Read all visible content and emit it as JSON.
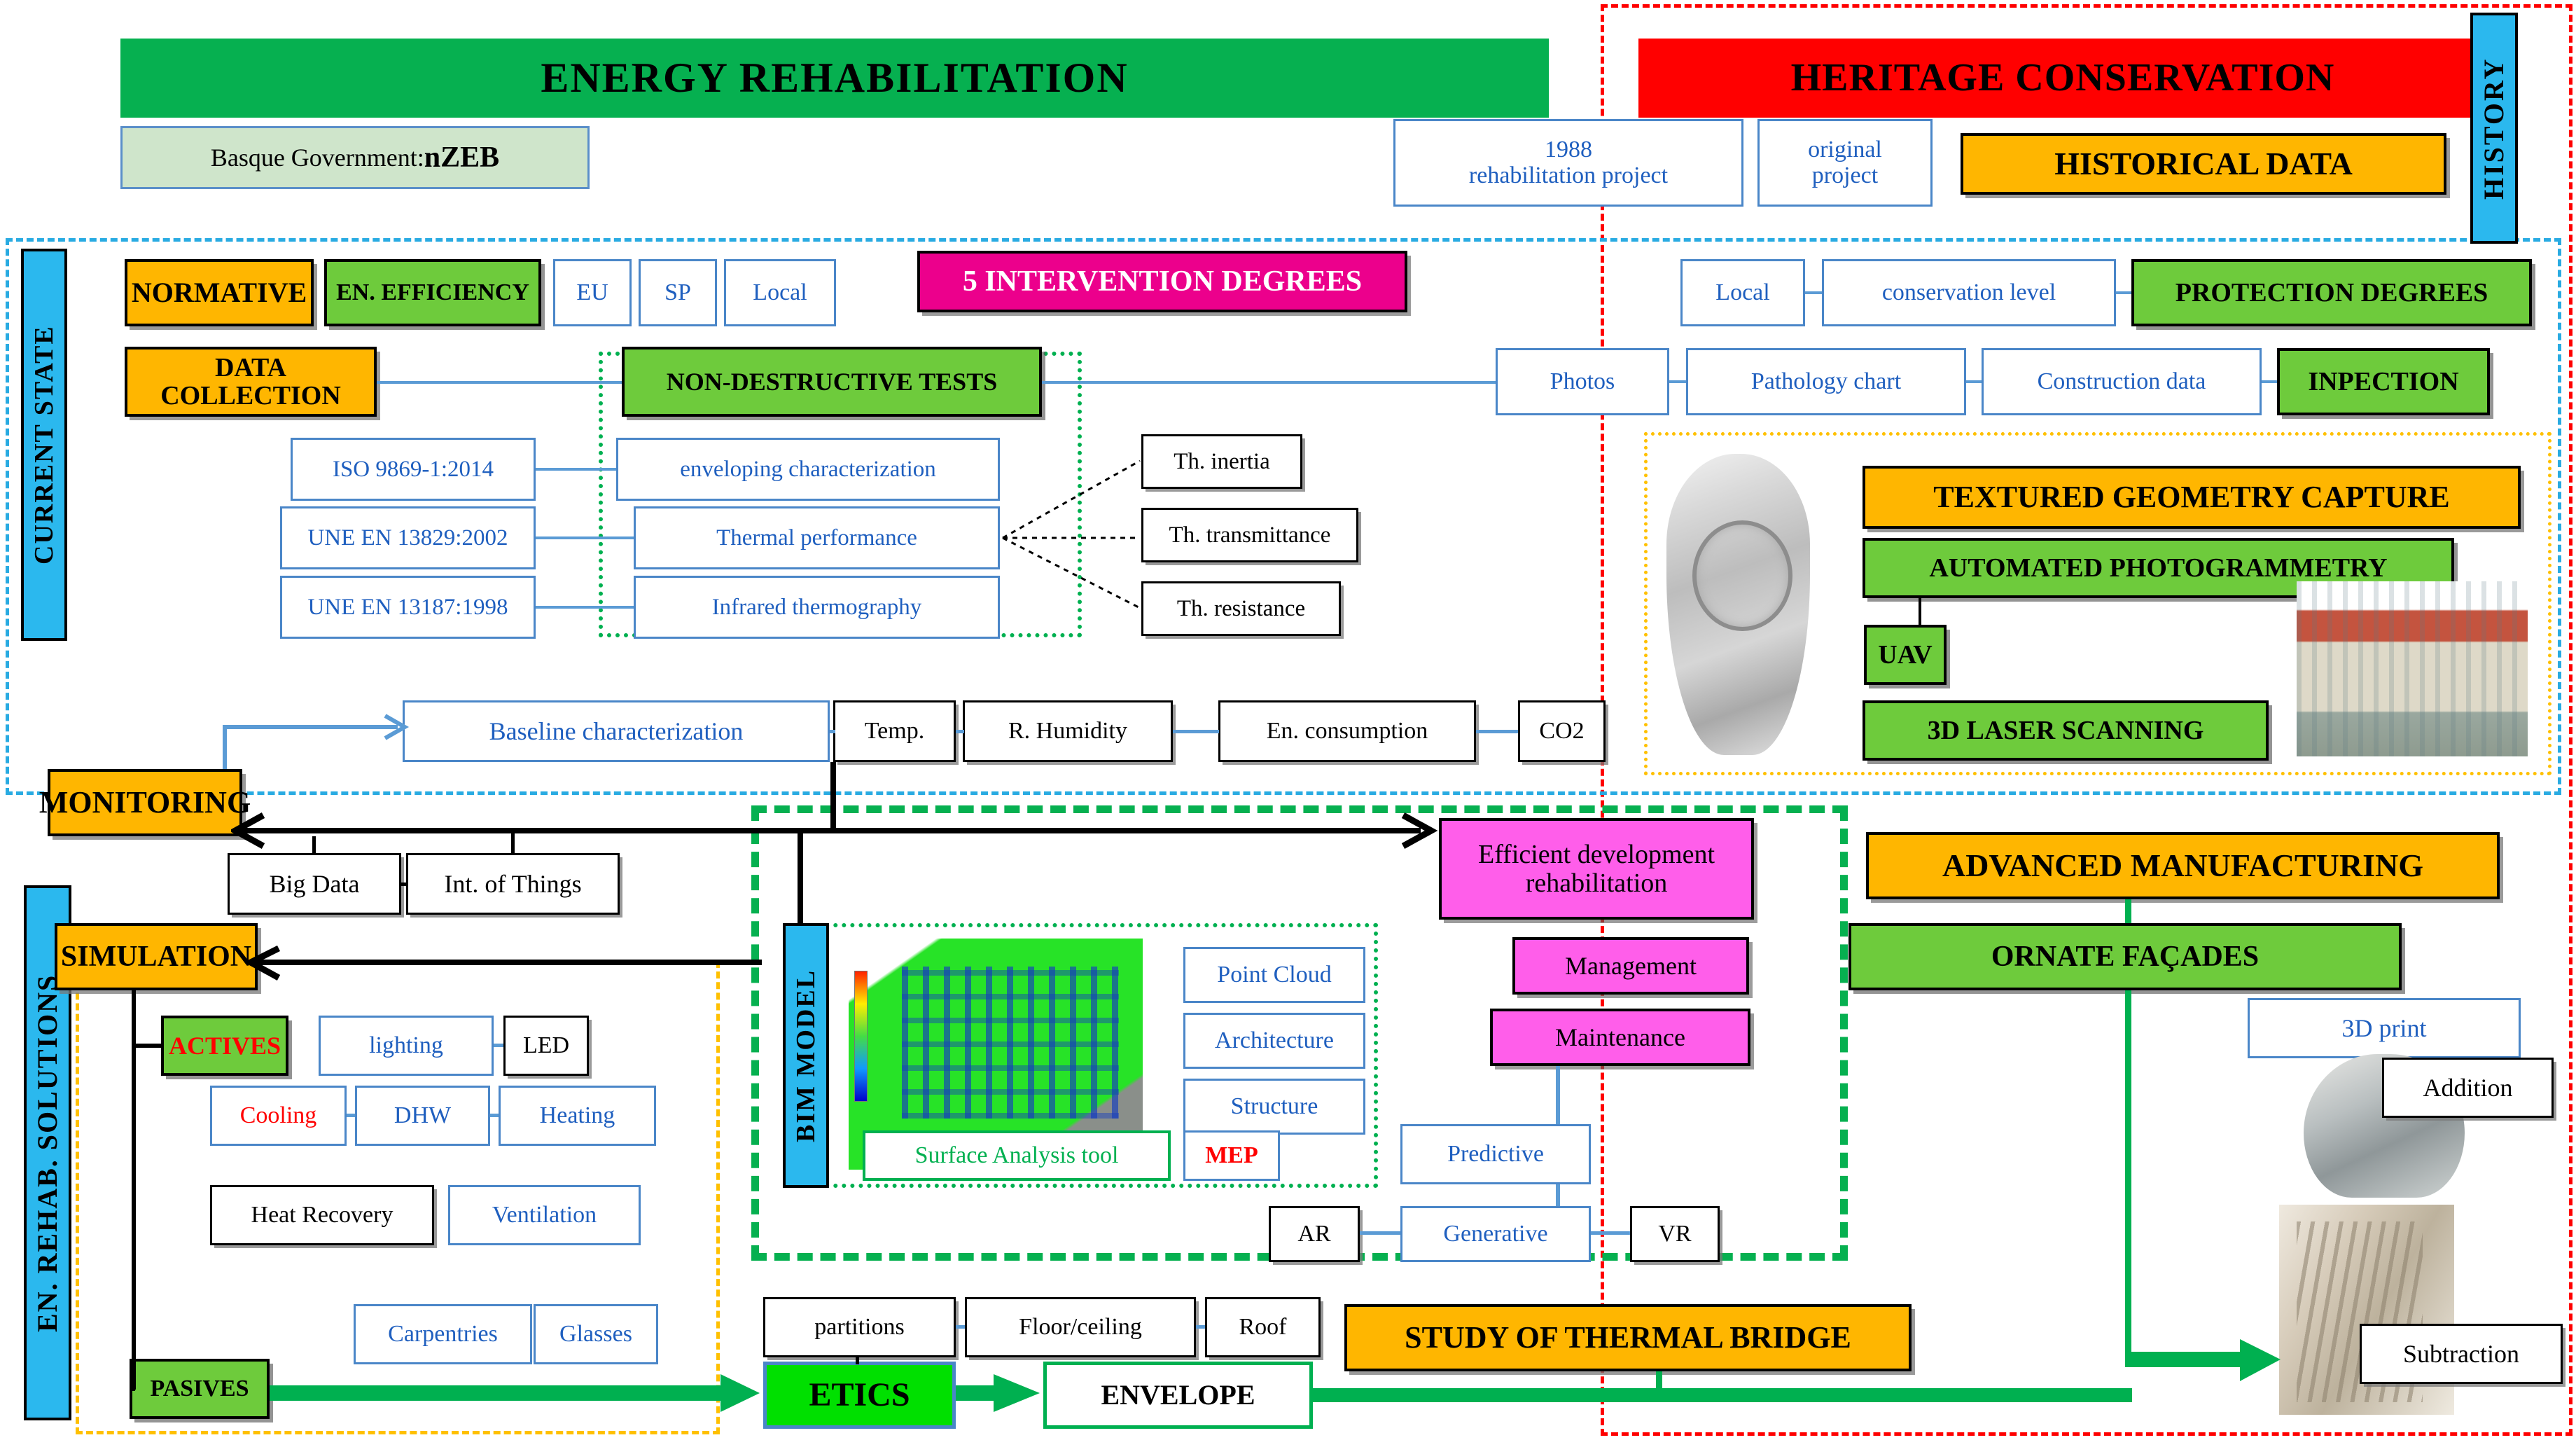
{
  "banners": {
    "energy_rehabilitation": "ENERGY REHABILITATION",
    "heritage_conservation": "HERITAGE CONSERVATION",
    "history": "HISTORY",
    "current_state": "CURRENT STATE",
    "en_rehab_solutions": "EN. REHAB. SOLUTIONS",
    "bim_model": "BIM  MODEL"
  },
  "top": {
    "basque_government": "Basque Government: ",
    "nzeb": "nZEB",
    "rehab_project_1988": "1988\nrehabilitation project",
    "original_project": "original\nproject",
    "historical_data": "HISTORICAL DATA"
  },
  "current_state": {
    "normative": "NORMATIVE",
    "en_efficiency": "EN. EFFICIENCY",
    "eu": "EU",
    "sp": "SP",
    "local": "Local",
    "intervention_degrees": "5 INTERVENTION DEGREES",
    "local_right": "Local",
    "conservation_level": "conservation level",
    "protection_degrees": "PROTECTION DEGREES",
    "data_collection": "DATA COLLECTION",
    "non_destructive_tests": "NON-DESTRUCTIVE TESTS",
    "photos": "Photos",
    "pathology_chart": "Pathology chart",
    "construction_data": "Construction data",
    "inpection": "INPECTION",
    "iso_9869": "ISO 9869-1:2014",
    "une_13829": "UNE EN 13829:2002",
    "une_13187": "UNE EN 13187:1998",
    "enveloping_characterization": "enveloping characterization",
    "thermal_performance": "Thermal performance",
    "infrared_thermography": "Infrared thermography",
    "th_inertia": "Th. inertia",
    "th_transmittance": "Th. transmittance",
    "th_resistance": "Th. resistance"
  },
  "geometry_capture": {
    "title": "TEXTURED GEOMETRY CAPTURE",
    "automated_photogrammetry": "AUTOMATED PHOTOGRAMMETRY",
    "uav": "UAV",
    "laser_scanning": "3D LASER SCANNING"
  },
  "monitoring": {
    "title": "MONITORING",
    "baseline_characterization": "Baseline characterization",
    "temp": "Temp.",
    "r_humidity": "R. Humidity",
    "en_consumption": "En. consumption",
    "co2": "CO2",
    "big_data": "Big Data",
    "int_of_things": "Int. of Things"
  },
  "simulation": {
    "title": "SIMULATION",
    "actives": "ACTIVES",
    "lighting": "lighting",
    "led": "LED",
    "cooling": "Cooling",
    "dhw": "DHW",
    "heating": "Heating",
    "heat_recovery": "Heat Recovery",
    "ventilation": "Ventilation",
    "pasives": "PASIVES",
    "carpentries": "Carpentries",
    "glasses": "Glasses"
  },
  "bim": {
    "point_cloud": "Point Cloud",
    "architecture": "Architecture",
    "structure": "Structure",
    "surface_analysis_tool": "Surface Analysis tool",
    "mep": "MEP"
  },
  "efficient": {
    "title": "Efficient development\nrehabilitation",
    "management": "Management",
    "maintenance": "Maintenance",
    "predictive": "Predictive",
    "generative": "Generative",
    "ar": "AR",
    "vr": "VR"
  },
  "manufacturing": {
    "title": "ADVANCED MANUFACTURING",
    "ornate_facades": "ORNATE FAÇADES",
    "print_3d": "3D print",
    "addition": "Addition",
    "subtraction": "Subtraction"
  },
  "bottom": {
    "partitions": "partitions",
    "floor_ceiling": "Floor/ceiling",
    "roof": "Roof",
    "etics": "ETICS",
    "envelope": "ENVELOPE",
    "thermal_bridge": "STUDY OF THERMAL BRIDGE"
  },
  "colors": {
    "green_banner": "#06B050",
    "red_banner": "#FF0000",
    "magenta_banner": "#EC008C",
    "orange_box": "#FFB600",
    "green_box": "#6ECB3C",
    "cyan_box": "#2BB8EE",
    "magenta_box": "#FF5EEA",
    "blue_text": "#1F5FBF",
    "red_text": "#FF0000",
    "etics_green": "#00E000"
  }
}
